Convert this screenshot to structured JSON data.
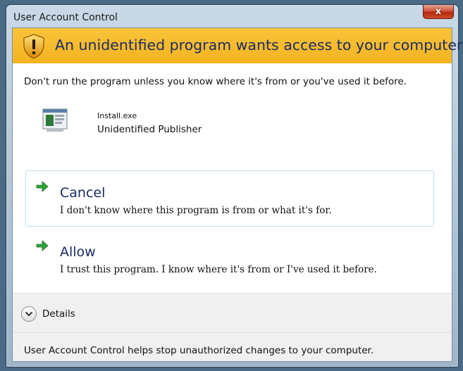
{
  "window": {
    "title": "User Account Control",
    "close_label": "x"
  },
  "banner": {
    "icon": "shield-warning-icon",
    "title": "An unidentified program wants access to your computer",
    "color": "#f6b82a"
  },
  "message": "Don't run the program unless you know where it's from or you've used it before.",
  "program": {
    "icon": "program-icon",
    "file_name": "Install.exe",
    "publisher": "Unidentified Publisher"
  },
  "options": [
    {
      "icon": "green-arrow-icon",
      "title": "Cancel",
      "description": "I don't know where this program is from or what it's for."
    },
    {
      "icon": "green-arrow-icon",
      "title": "Allow",
      "description": "I trust this program. I know where it's from or I've used it before."
    }
  ],
  "details": {
    "icon": "chevron-down-icon",
    "label": "Details"
  },
  "footer": {
    "text": "User Account Control helps stop unauthorized changes to your computer."
  }
}
